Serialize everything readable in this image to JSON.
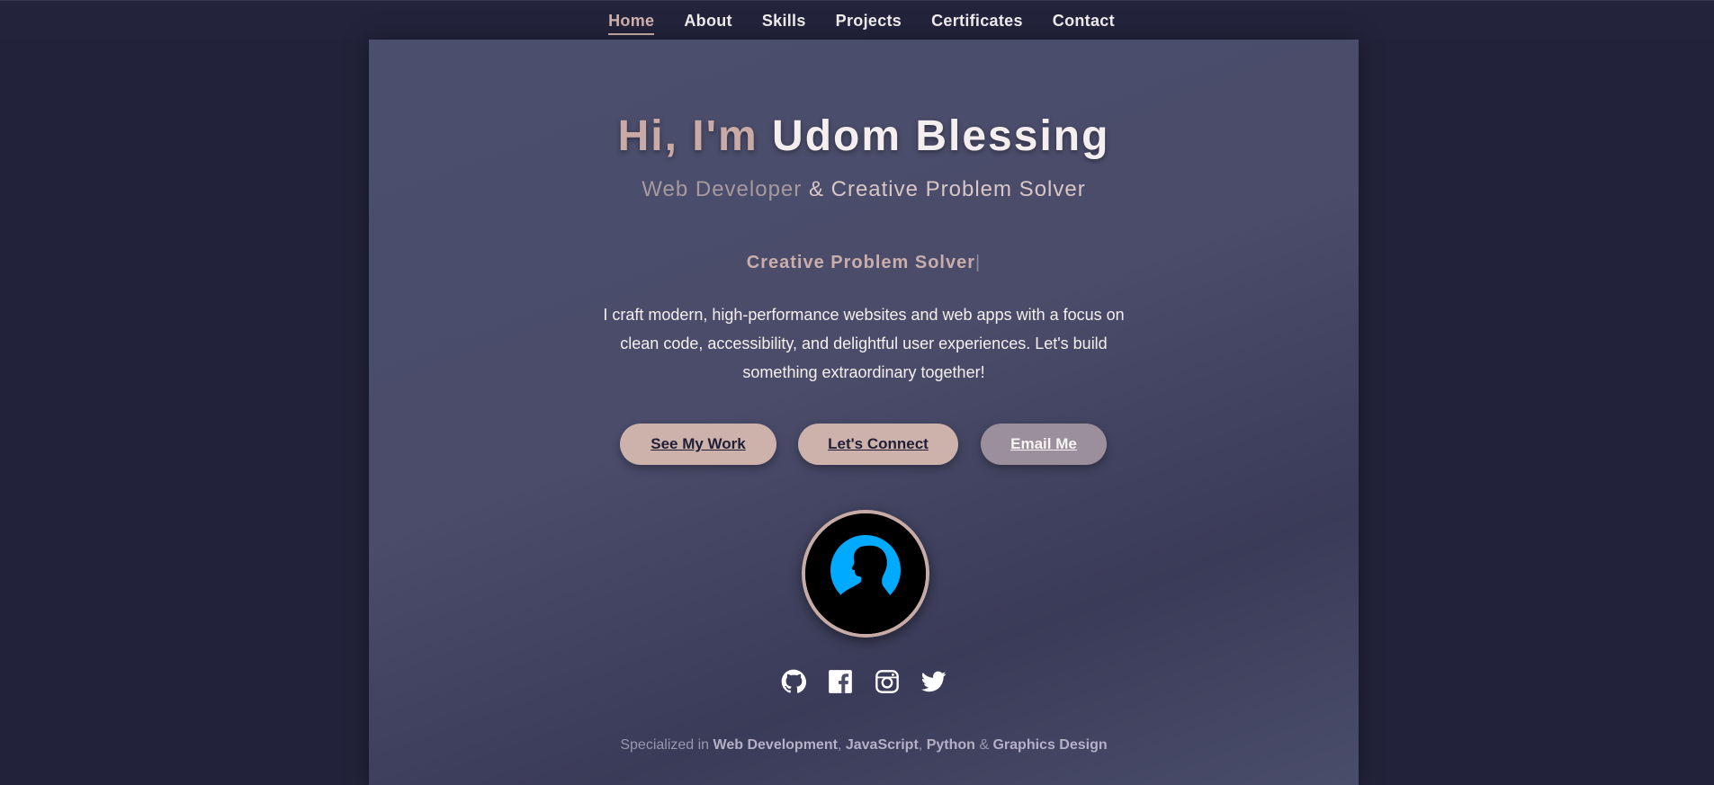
{
  "nav": {
    "items": [
      {
        "label": "Home",
        "active": true
      },
      {
        "label": "About"
      },
      {
        "label": "Skills"
      },
      {
        "label": "Projects"
      },
      {
        "label": "Certificates"
      },
      {
        "label": "Contact"
      }
    ]
  },
  "hero": {
    "greeting": "Hi, I'm",
    "name": "Udom Blessing",
    "subtitle_role": "Web Developer",
    "subtitle_rest": "& Creative Problem Solver",
    "typed_text": "Creative Problem Solver",
    "typed_caret": "|",
    "description": "I craft modern, high-performance websites and web apps with a focus on clean code, accessibility, and delightful user experiences. Let's build something extraordinary together!"
  },
  "buttons": {
    "work": "See My Work",
    "connect": "Let's Connect",
    "email": "Email Me"
  },
  "socials": [
    "github-icon",
    "facebook-icon",
    "instagram-icon",
    "twitter-icon"
  ],
  "footer": {
    "prefix": "Specialized in",
    "skill1": "Web Development",
    "sep1": ",",
    "skill2": "JavaScript",
    "sep2": ",",
    "skill3": "Python",
    "amp": "&",
    "skill4": "Graphics Design"
  },
  "colors": {
    "background": "#22223a",
    "panel": "#4b4e6c",
    "accent": "#cdb2ac",
    "email_button": "#9b8f9c",
    "avatar_ring": "#00aaff"
  }
}
